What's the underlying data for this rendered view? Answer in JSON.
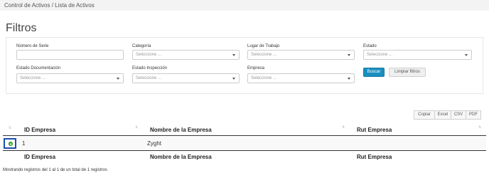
{
  "breadcrumb": "Control de Activos / Lista de Activos",
  "page_title": "Filtros",
  "filters": {
    "serial_label": "Número de Serie",
    "serial_value": "",
    "category_label": "Categoría",
    "category_placeholder": "Seleccione ...",
    "workplace_label": "Lugar de Trabajo",
    "workplace_placeholder": "Seleccione ...",
    "state_label": "Estado",
    "state_placeholder": "Seleccione ...",
    "doc_state_label": "Estado Documentación",
    "doc_state_placeholder": "Seleccione ...",
    "inspection_label": "Estado Inspección",
    "inspection_placeholder": "Seleccione ...",
    "company_label": "Empresa",
    "company_placeholder": "Seleccione ...",
    "search_button": "Buscar",
    "clear_button": "Limpiar filtros"
  },
  "export_buttons": [
    "Copiar",
    "Excel",
    "CSV",
    "PDF"
  ],
  "table": {
    "columns": [
      "ID Empresa",
      "Nombre de la Empresa",
      "Rut Empresa"
    ],
    "rows": [
      {
        "id": "1",
        "name": "Zyght",
        "rut": ""
      }
    ],
    "info": "Mostrando registros del 1 al 1 de un total de 1 registros"
  },
  "colors": {
    "primary_button": "#1a8fbf",
    "expand_icon": "#31b131",
    "focus_outline": "#1c4fb0"
  },
  "icons": {
    "sort": "sort-both-icon",
    "expand": "plus-circle-icon",
    "dropdown": "caret-down-icon"
  }
}
